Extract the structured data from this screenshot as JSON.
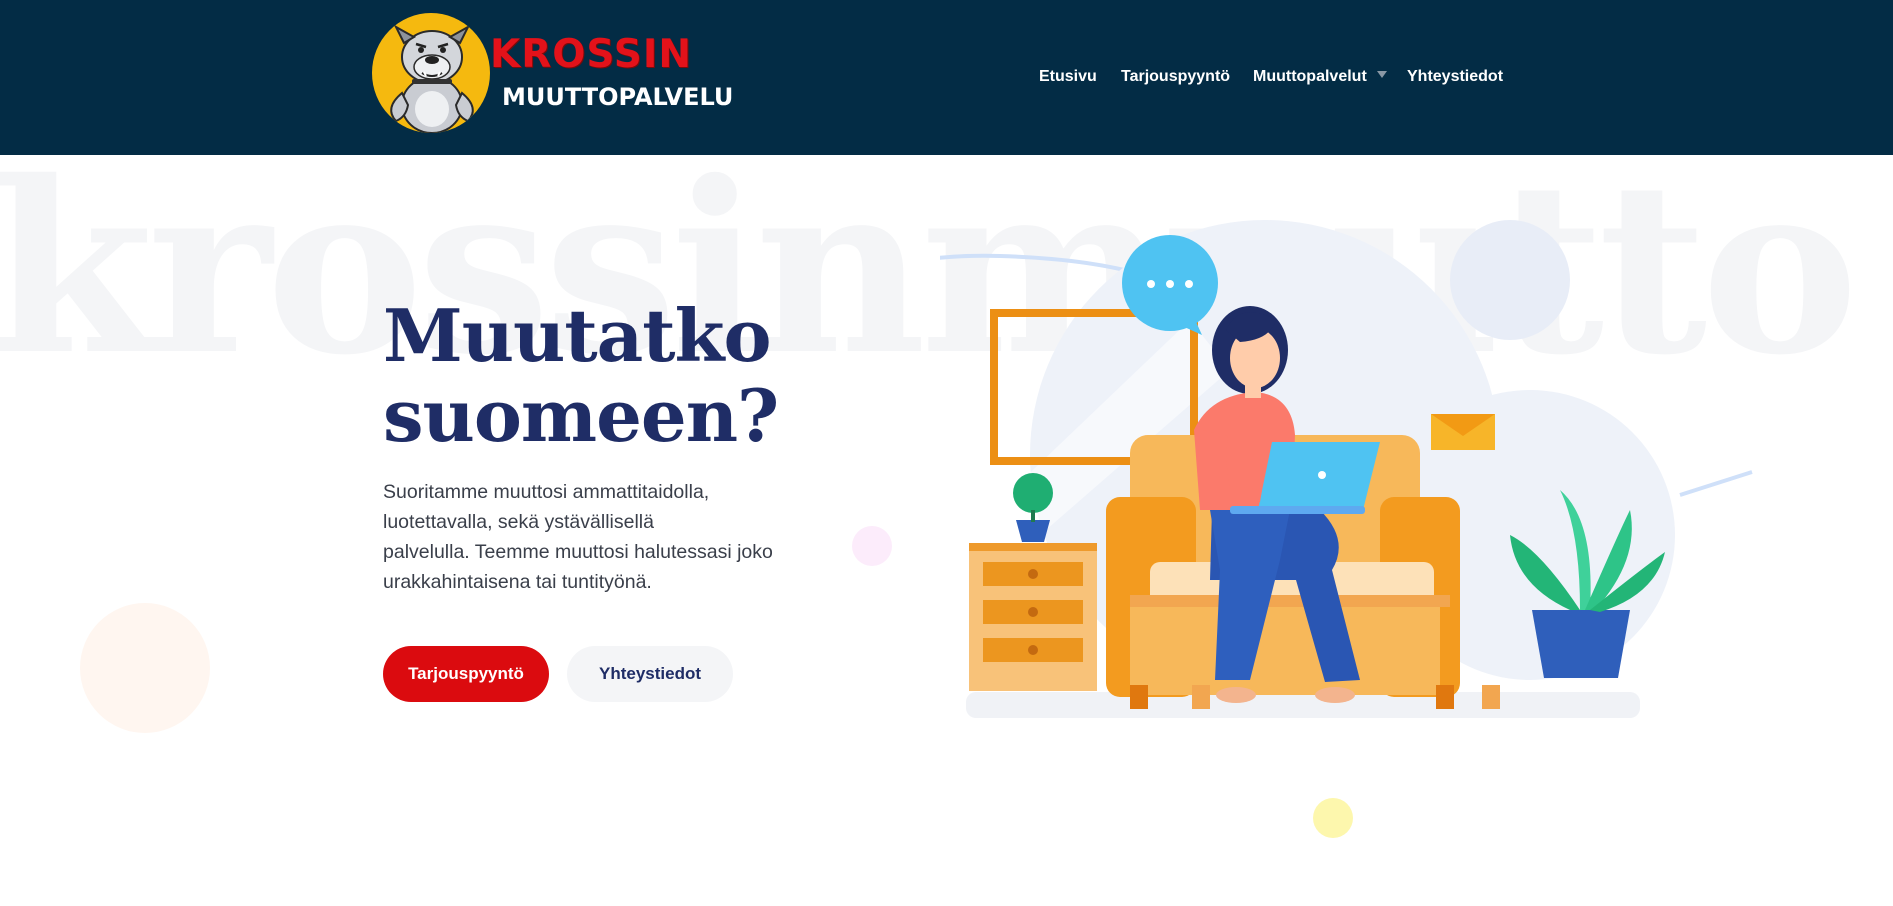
{
  "header": {
    "logo": {
      "brand": "KROSSIN",
      "subtitle": "MUUTTOPALVELU",
      "icon": "bulldog-mascot-icon"
    },
    "nav": [
      {
        "label": "Etusivu"
      },
      {
        "label": "Tarjouspyyntö"
      },
      {
        "label": "Muuttopalvelut",
        "has_dropdown": true
      },
      {
        "label": "Yhteystiedot"
      }
    ]
  },
  "hero": {
    "watermark": "krossinmuutto",
    "title_line1": "Muutatko",
    "title_line2": "suomeen?",
    "text_line1": "Suoritamme muuttosi ammattitaidolla,",
    "text_line2": "luotettavalla, sekä ystävällisellä",
    "text_line3": "palvelulla. Teemme muuttosi halutessasi joko",
    "text_line4": "urakkahintaisena tai tuntityönä.",
    "primary_button": "Tarjouspyyntö",
    "secondary_button": "Yhteystiedot"
  },
  "colors": {
    "header_bg": "#032c45",
    "title": "#1f2d66",
    "primary_button": "#db0b0f",
    "brand_red": "#e3121a",
    "logo_yellow": "#f5b90f"
  }
}
